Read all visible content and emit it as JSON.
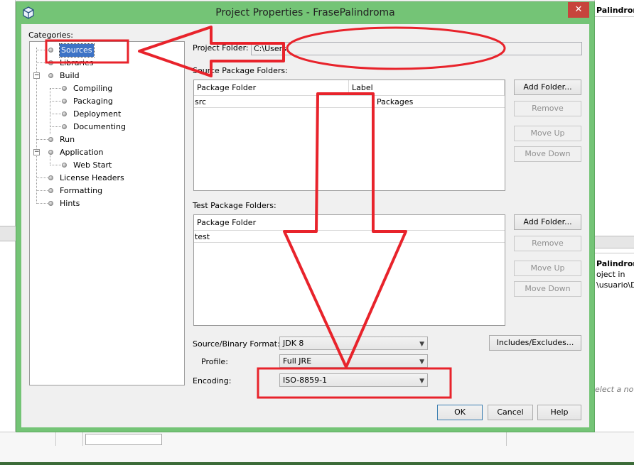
{
  "background": {
    "right_tab_title": "Palindroma",
    "right_nav_title": "Palindroma",
    "right_nav_lines": [
      "oject in",
      "\\usuario\\Do"
    ],
    "right_hint": "elect a noti"
  },
  "dialog": {
    "title": "Project Properties - FrasePalindroma",
    "close_glyph": "✕",
    "categories_label": "Categories:",
    "tree": {
      "sources": "Sources",
      "libraries": "Libraries",
      "build": "Build",
      "compiling": "Compiling",
      "packaging": "Packaging",
      "deployment": "Deployment",
      "documenting": "Documenting",
      "run": "Run",
      "application": "Application",
      "web_start": "Web Start",
      "license_headers": "License Headers",
      "formatting": "Formatting",
      "hints": "Hints"
    },
    "project_folder_label": "Project Folder:",
    "project_folder_value": "C:\\Users",
    "source_folders_label": "Source Package Folders:",
    "source_table": {
      "col_package_folder": "Package Folder",
      "col_label": "Label",
      "row_folder": "src",
      "row_label": "Packages"
    },
    "test_folders_label": "Test Package Folders:",
    "test_table": {
      "col_package_folder": "Package Folder",
      "row_folder": "test"
    },
    "buttons": {
      "add_folder": "Add Folder...",
      "remove": "Remove",
      "move_up": "Move Up",
      "move_down": "Move Down",
      "includes_excludes": "Includes/Excludes...",
      "ok": "OK",
      "cancel": "Cancel",
      "help": "Help"
    },
    "source_binary_format_label": "Source/Binary Format:",
    "source_binary_format_value": "JDK 8",
    "profile_label": "Profile:",
    "profile_value": "Full JRE",
    "encoding_label": "Encoding:",
    "encoding_value": "ISO-8859-1"
  },
  "annotation_color": "#e8232b"
}
